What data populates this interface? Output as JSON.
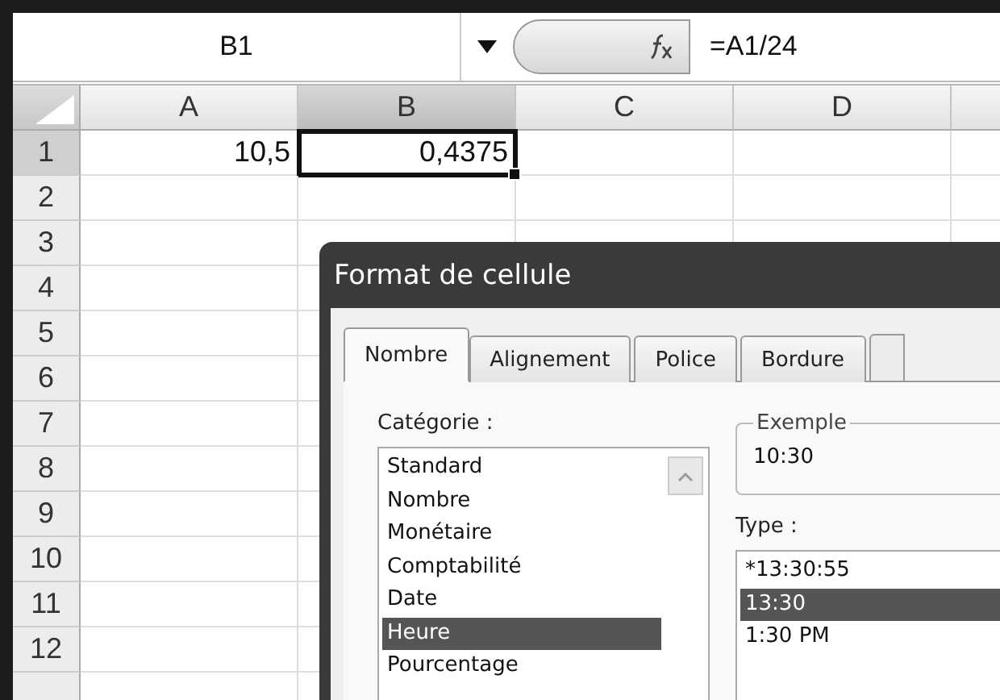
{
  "name_box": "B1",
  "formula": "=A1/24",
  "columns": [
    "A",
    "B",
    "C",
    "D"
  ],
  "rows": [
    {
      "label": "1",
      "cells": [
        {
          "text": "10,5",
          "selected": false
        },
        {
          "text": "0,4375",
          "selected": true
        }
      ]
    },
    {
      "label": "2"
    },
    {
      "label": "3"
    },
    {
      "label": "4"
    },
    {
      "label": "5"
    },
    {
      "label": "6"
    },
    {
      "label": "7"
    },
    {
      "label": "8"
    },
    {
      "label": "9"
    },
    {
      "label": "10"
    },
    {
      "label": "11"
    },
    {
      "label": "12"
    }
  ],
  "dialog": {
    "title": "Format de cellule",
    "tabs": [
      {
        "label": "Nombre",
        "selected": true
      },
      {
        "label": "Alignement",
        "selected": false
      },
      {
        "label": "Police",
        "selected": false
      },
      {
        "label": "Bordure",
        "selected": false
      }
    ],
    "category_label": "Catégorie :",
    "categories": [
      {
        "label": "Standard",
        "selected": false
      },
      {
        "label": "Nombre",
        "selected": false
      },
      {
        "label": "Monétaire",
        "selected": false
      },
      {
        "label": "Comptabilité",
        "selected": false
      },
      {
        "label": "Date",
        "selected": false
      },
      {
        "label": "Heure",
        "selected": true
      },
      {
        "label": "Pourcentage",
        "selected": false
      }
    ],
    "example": {
      "legend": "Exemple",
      "value": "10:30"
    },
    "type_label": "Type :",
    "types": [
      {
        "label": "*13:30:55",
        "selected": false
      },
      {
        "label": "13:30",
        "selected": true
      },
      {
        "label": "1:30 PM",
        "selected": false
      }
    ]
  }
}
